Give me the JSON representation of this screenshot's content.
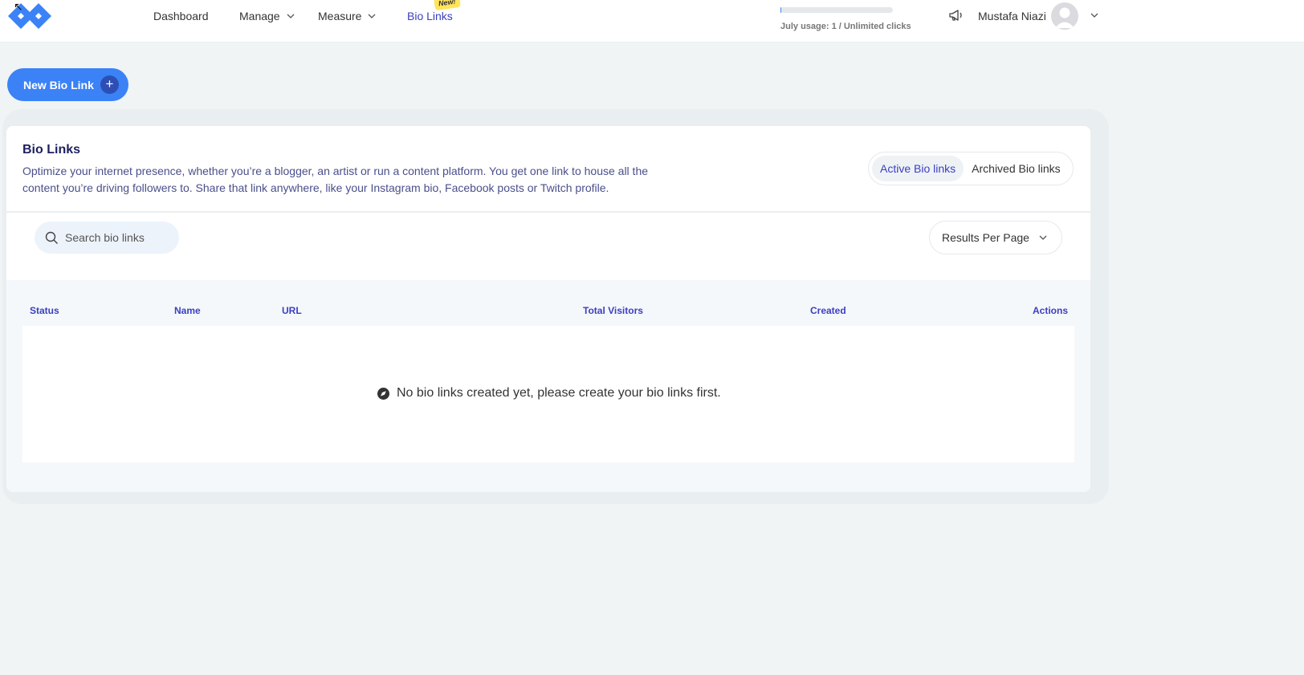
{
  "nav": {
    "items": [
      {
        "label": "Dashboard"
      },
      {
        "label": "Manage"
      },
      {
        "label": "Measure"
      },
      {
        "label": "Bio Links",
        "badge": "New!"
      }
    ],
    "usage_text": "July usage: 1 / Unlimited clicks",
    "user_name": "Mustafa Niazi",
    "icons": [
      "logo",
      "chevron-down-icon",
      "megaphone-icon",
      "avatar"
    ]
  },
  "new_button": {
    "label": "New Bio Link",
    "icon": "+"
  },
  "card": {
    "title": "Bio Links",
    "description": "Optimize your internet presence, whether you’re a blogger, an artist or run a content platform. You get one link to house all the content you’re driving followers to. Share that link anywhere, like your Instagram bio, Facebook posts or Twitch profile.",
    "toggle": {
      "active": "Active Bio links",
      "archived": "Archived Bio links"
    }
  },
  "filters": {
    "search_placeholder": "Search bio links",
    "results_per_page": "Results Per Page"
  },
  "table": {
    "columns": [
      "Status",
      "Name",
      "URL",
      "Total Visitors",
      "Created",
      "Actions"
    ],
    "empty_message": "No bio links created yet, please create your bio links first."
  },
  "colors": {
    "accent": "#3b82f6",
    "nav_active": "#3b3fbf",
    "page_bg": "#f0f4f5",
    "badge": "#ffe45c"
  }
}
